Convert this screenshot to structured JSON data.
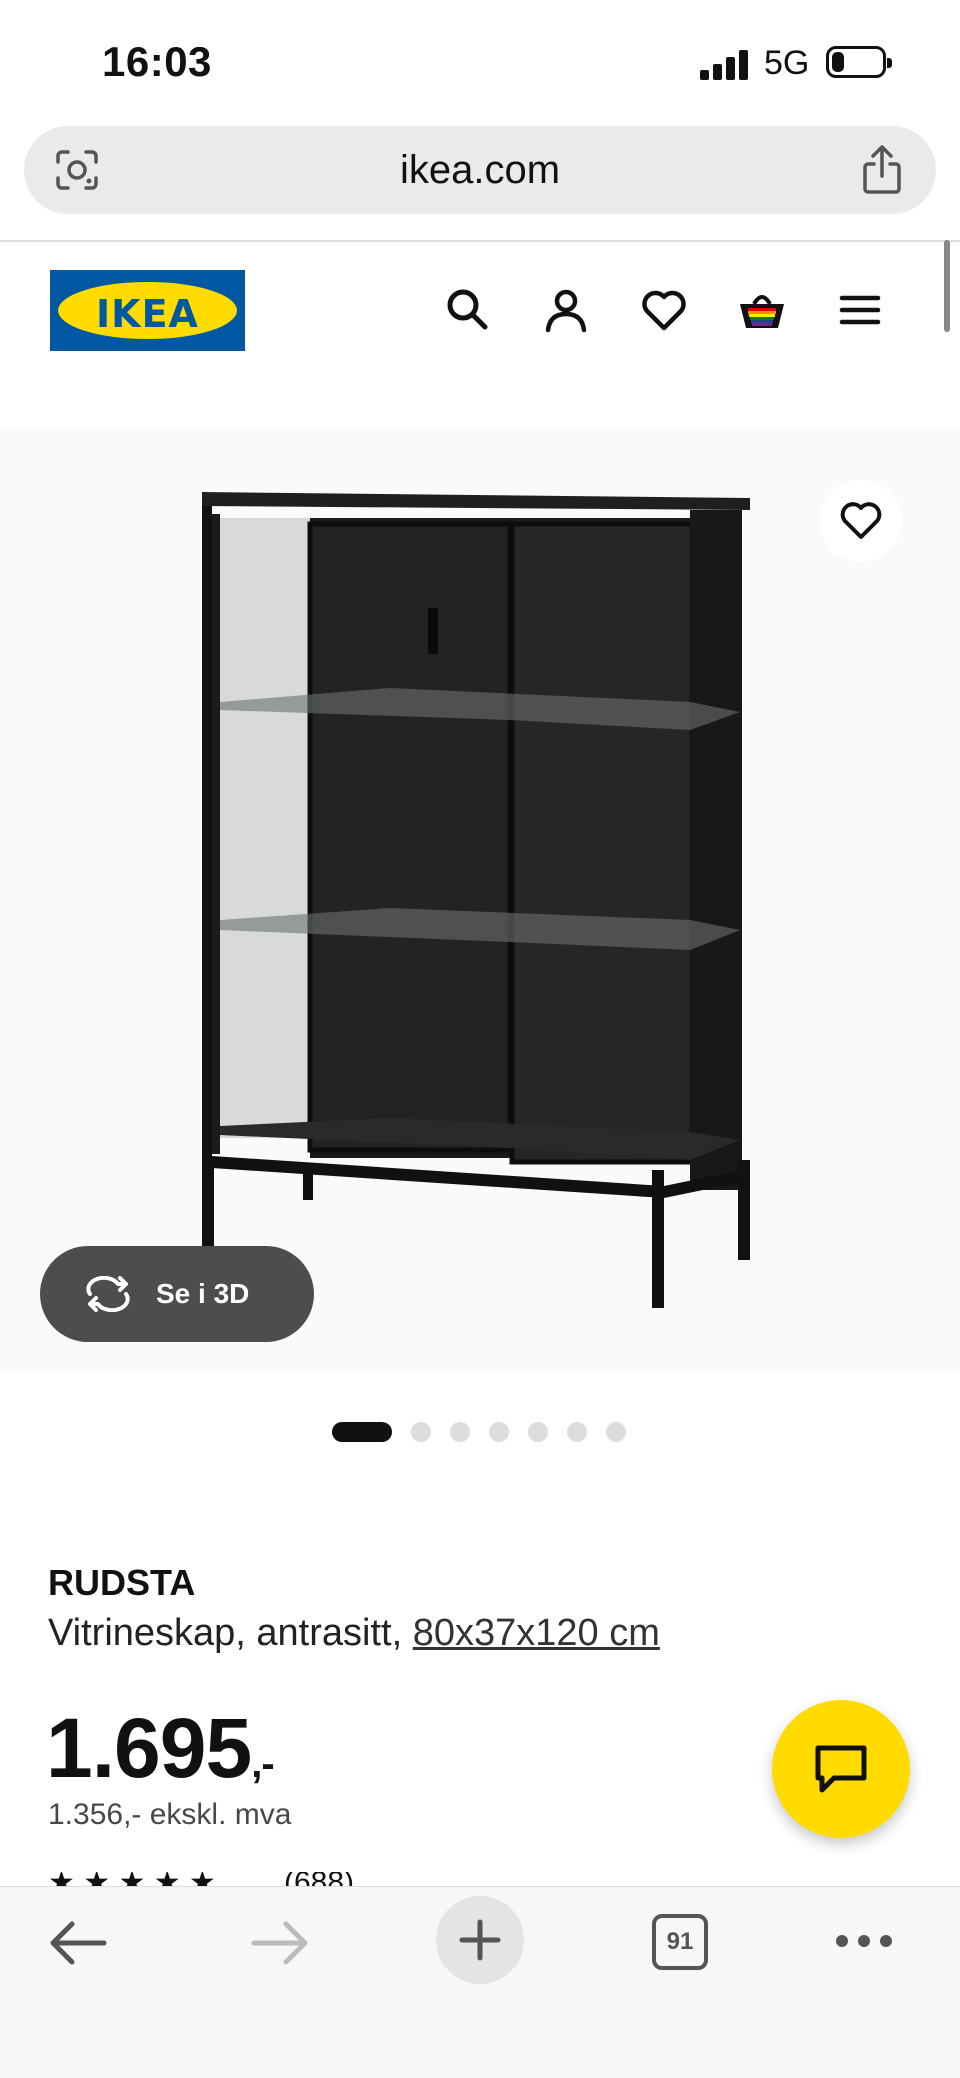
{
  "status_bar": {
    "time": "16:03",
    "network": "5G",
    "battery_level": 0.25
  },
  "browser": {
    "url": "ikea.com",
    "tabs_count": "91"
  },
  "header": {
    "logo_text": "IKEA",
    "icons": [
      "search-icon",
      "account-icon",
      "favourites-icon",
      "basket-icon",
      "menu-icon"
    ]
  },
  "product_image": {
    "view_3d_label": "Se i 3D",
    "gallery_total": 7,
    "gallery_active_index": 0
  },
  "product": {
    "name": "RUDSTA",
    "description": "Vitrineskap, antrasitt,",
    "dimensions": "80x37x120 cm",
    "price": "1.695",
    "price_suffix": ",-",
    "price_excl_vat": "1.356,- ekskl. mva",
    "rating_count": "(688)"
  },
  "colors": {
    "ikea_blue": "#0058a3",
    "ikea_yellow": "#ffdb00",
    "dark_button": "#4d4d4d"
  }
}
